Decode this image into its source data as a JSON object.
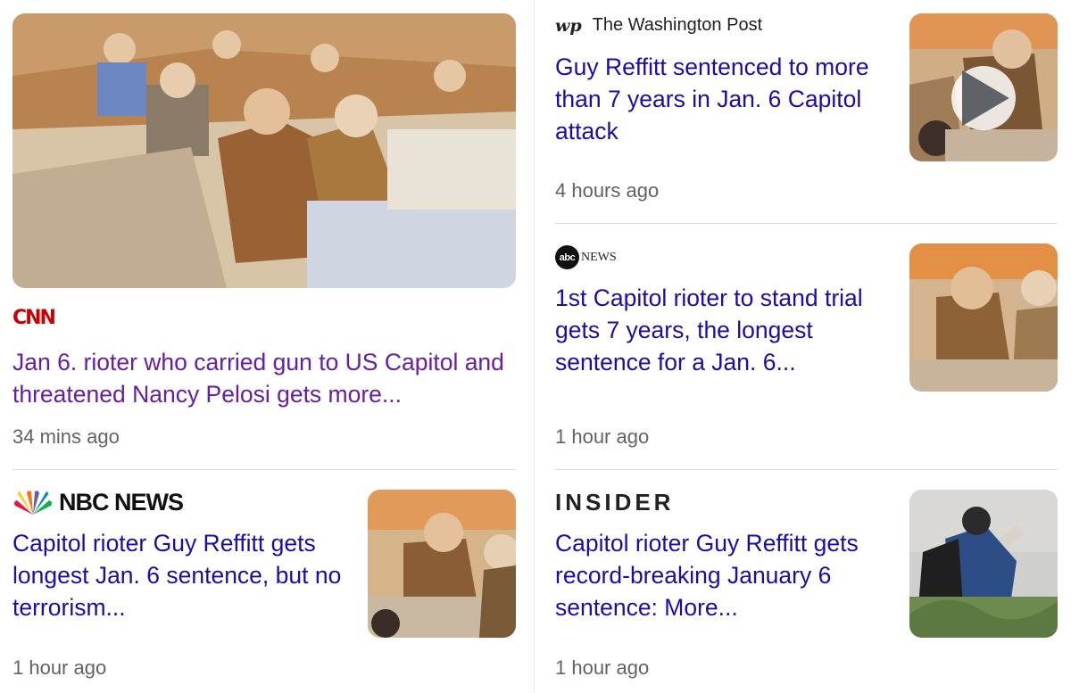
{
  "articles": [
    {
      "source": "CNN",
      "headline": "Jan 6. rioter who carried gun to US Capitol and threatened Nancy Pelosi gets more...",
      "time": "34 mins ago"
    },
    {
      "source": "The Washington Post",
      "source_mark": "wp",
      "headline": "Guy Reffitt sentenced to more than 7 years in Jan. 6 Capitol attack",
      "time": "4 hours ago",
      "has_video": true
    },
    {
      "source_mark": "abc",
      "source": "NEWS",
      "headline": "1st Capitol rioter to stand trial gets 7 years, the longest sentence for a Jan. 6...",
      "time": "1 hour ago"
    },
    {
      "source": "NBC NEWS",
      "headline": "Capitol rioter Guy Reffitt gets longest Jan. 6 sentence, but no terrorism...",
      "time": "1 hour ago"
    },
    {
      "source": "INSIDER",
      "headline": "Capitol rioter Guy Reffitt gets record-breaking January 6 sentence: More...",
      "time": "1 hour ago"
    }
  ],
  "colors": {
    "link": "#1a0dab",
    "visited_link": "#681da8",
    "time": "#5f6368",
    "cnn_red": "#cc0000",
    "divider": "#dadce0"
  }
}
